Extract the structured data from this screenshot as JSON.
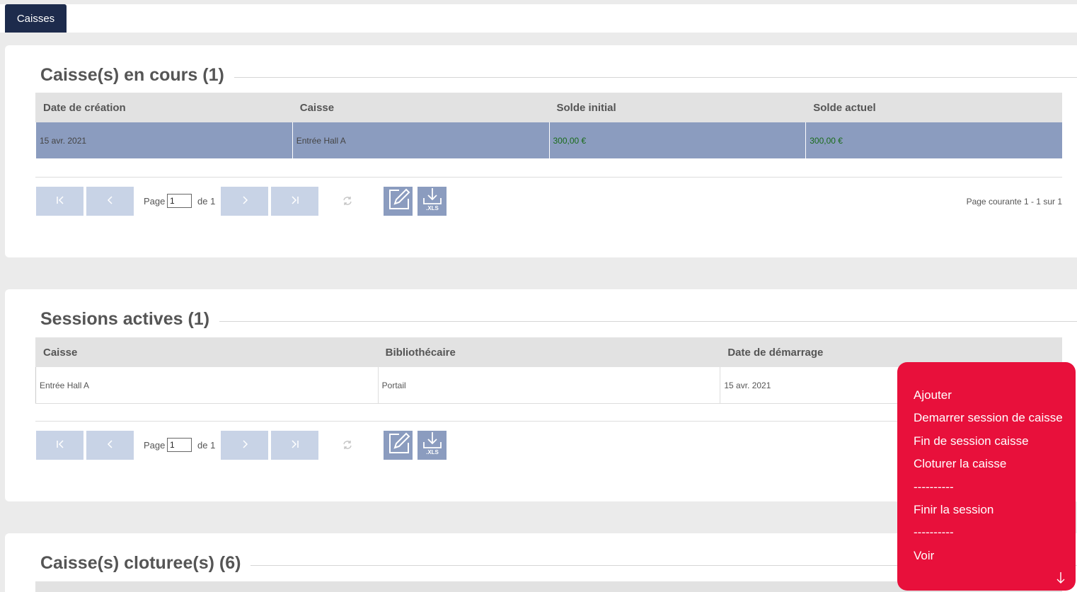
{
  "tabs": {
    "caisses": "Caisses"
  },
  "section1": {
    "title": "Caisse(s) en cours (1)",
    "columns": [
      "Date de création",
      "Caisse",
      "Solde initial",
      "Solde actuel"
    ],
    "rows": [
      [
        "15 avr. 2021",
        "Entrée Hall A",
        "300,00 €",
        "300,00 €"
      ]
    ],
    "pager": {
      "page_label": "Page",
      "page_value": "1",
      "of_label": "de 1",
      "info": "Page courante 1 - 1 sur 1"
    }
  },
  "section2": {
    "title": "Sessions actives (1)",
    "columns": [
      "Caisse",
      "Bibliothécaire",
      "Date de démarrage"
    ],
    "rows": [
      [
        "Entrée Hall A",
        "Portail",
        "15 avr. 2021"
      ]
    ],
    "pager": {
      "page_label": "Page",
      "page_value": "1",
      "of_label": "de 1"
    }
  },
  "section3": {
    "title": "Caisse(s) cloturee(s) (6)"
  },
  "context_menu": {
    "items": [
      "Ajouter",
      "Demarrer session de caisse",
      "Fin de session caisse",
      "Cloturer la caisse",
      "----------",
      "Finir la session",
      "----------",
      "Voir"
    ]
  },
  "icons": {
    "first": "first-page-icon",
    "prev": "previous-page-icon",
    "next": "next-page-icon",
    "last": "last-page-icon",
    "refresh": "refresh-icon",
    "edit": "edit-icon",
    "xls": "xls-download-icon",
    "xls_text": ".XLS"
  },
  "colors": {
    "tab": "#1d2b4c",
    "selected_row": "#8b9cbf",
    "pager_button": "#c8d3e6",
    "menu": "#e8103b",
    "money": "#1a6b1a"
  }
}
